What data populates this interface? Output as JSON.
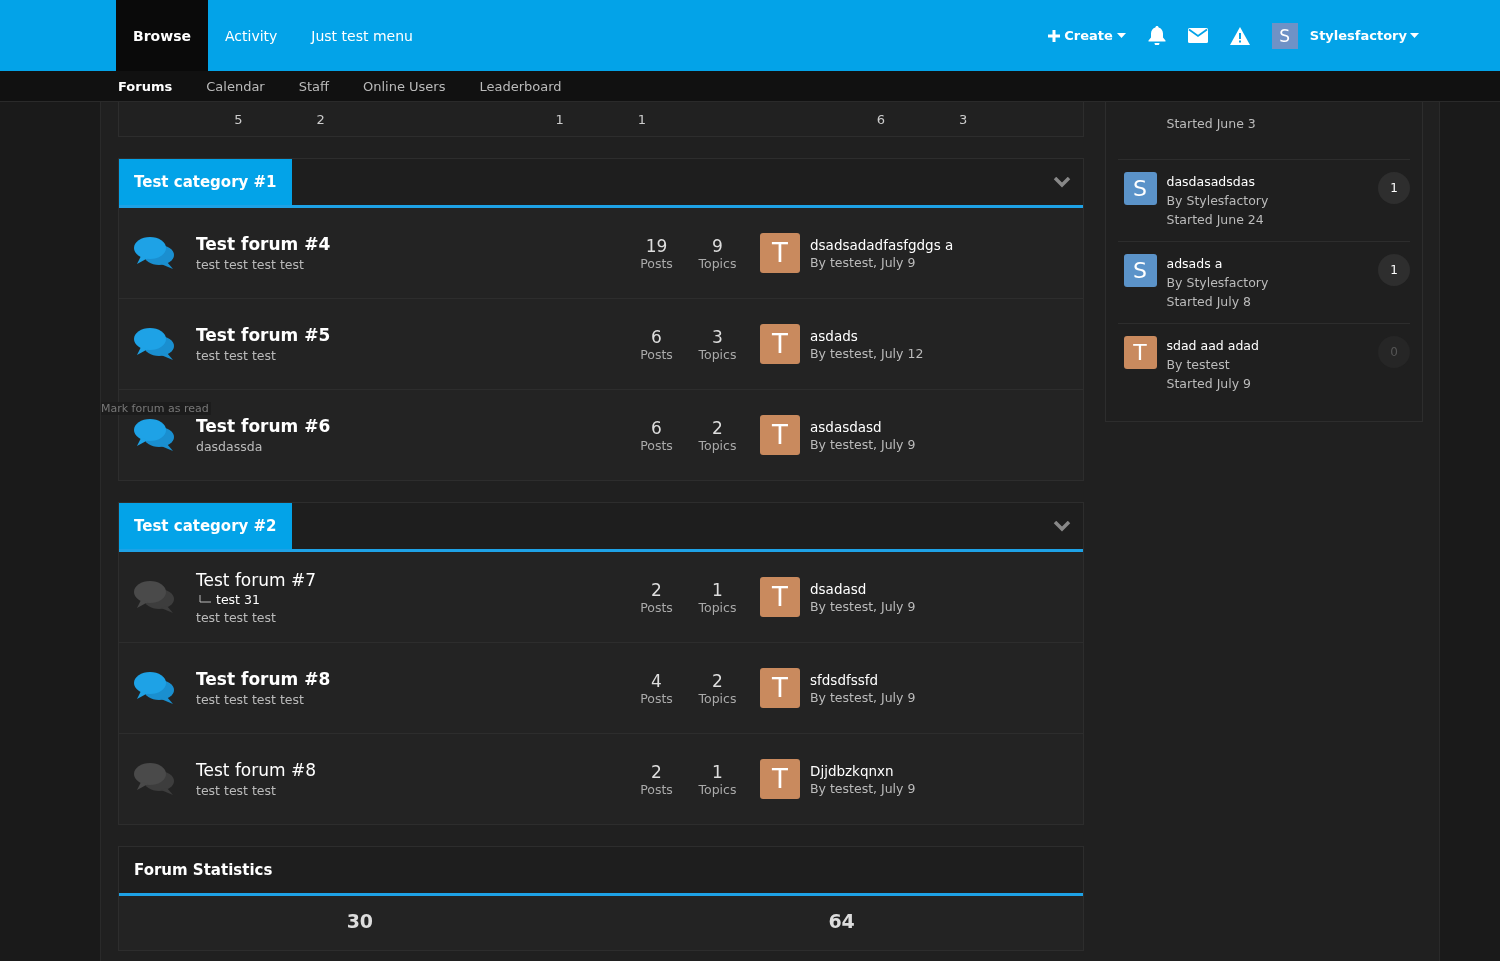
{
  "header": {
    "nav": [
      {
        "label": "Browse",
        "selected": true
      },
      {
        "label": "Activity",
        "selected": false
      },
      {
        "label": "Just test menu",
        "selected": false
      }
    ],
    "create": "Create",
    "user_initial": "S",
    "user_name": "Stylesfactory"
  },
  "subnav": [
    {
      "label": "Forums",
      "selected": true
    },
    {
      "label": "Calendar",
      "selected": false
    },
    {
      "label": "Staff",
      "selected": false
    },
    {
      "label": "Online Users",
      "selected": false
    },
    {
      "label": "Leaderboard",
      "selected": false
    }
  ],
  "previous_stats": [
    [
      "5",
      "2"
    ],
    [
      "1",
      "1"
    ],
    [
      "6",
      "3"
    ]
  ],
  "categories": [
    {
      "title": "Test category #1",
      "forums": [
        {
          "title": "Test forum #4",
          "unread": true,
          "description": "test test test test",
          "posts": "19",
          "posts_label": "Posts",
          "topics": "9",
          "topics_label": "Topics",
          "avatar": "T",
          "color": "#c98a5e",
          "last_title": "dsadsadadfasfgdgs a",
          "last_by": "By testest, July 9"
        },
        {
          "title": "Test forum #5",
          "unread": true,
          "description": "test test test",
          "posts": "6",
          "posts_label": "Posts",
          "topics": "3",
          "topics_label": "Topics",
          "avatar": "T",
          "color": "#c98a5e",
          "last_title": "asdads",
          "last_by": "By testest, July 12"
        },
        {
          "title": "Test forum #6",
          "unread": true,
          "tooltip": "Mark forum as read",
          "description": "dasdassda",
          "posts": "6",
          "posts_label": "Posts",
          "topics": "2",
          "topics_label": "Topics",
          "avatar": "T",
          "color": "#c98a5e",
          "last_title": "asdasdasd",
          "last_by": "By testest, July 9"
        }
      ]
    },
    {
      "title": "Test category #2",
      "forums": [
        {
          "title": "Test forum #7",
          "unread": false,
          "subforum": "test 31",
          "description": "test test test",
          "posts": "2",
          "posts_label": "Posts",
          "topics": "1",
          "topics_label": "Topics",
          "avatar": "T",
          "color": "#c98a5e",
          "last_title": "dsadasd",
          "last_by": "By testest, July 9"
        },
        {
          "title": "Test forum #8",
          "unread": true,
          "description": "test test test test",
          "posts": "4",
          "posts_label": "Posts",
          "topics": "2",
          "topics_label": "Topics",
          "avatar": "T",
          "color": "#c98a5e",
          "last_title": "sfdsdfssfd",
          "last_by": "By testest, July 9"
        },
        {
          "title": "Test forum #8",
          "unread": false,
          "description": "test test test",
          "posts": "2",
          "posts_label": "Posts",
          "topics": "1",
          "topics_label": "Topics",
          "avatar": "T",
          "color": "#c98a5e",
          "last_title": "Djjdbzkqnxn",
          "last_by": "By testest, July 9"
        }
      ]
    }
  ],
  "statistics": {
    "title": "Forum Statistics",
    "values": [
      "30",
      "64"
    ]
  },
  "sidebar_topics": [
    {
      "started": "Started June 3"
    },
    {
      "avatar": "S",
      "color": "#5b93c9",
      "title": "dasdasadsdas",
      "by": "By Stylesfactory",
      "started": "Started June 24",
      "replies": "1",
      "unread": true
    },
    {
      "avatar": "S",
      "color": "#5b93c9",
      "title": "adsads a",
      "by": "By Stylesfactory",
      "started": "Started July 8",
      "replies": "1",
      "unread": true
    },
    {
      "avatar": "T",
      "color": "#c98a5e",
      "title": "sdad aad adad",
      "by": "By testest",
      "started": "Started July 9",
      "replies": "0",
      "unread": false
    }
  ]
}
